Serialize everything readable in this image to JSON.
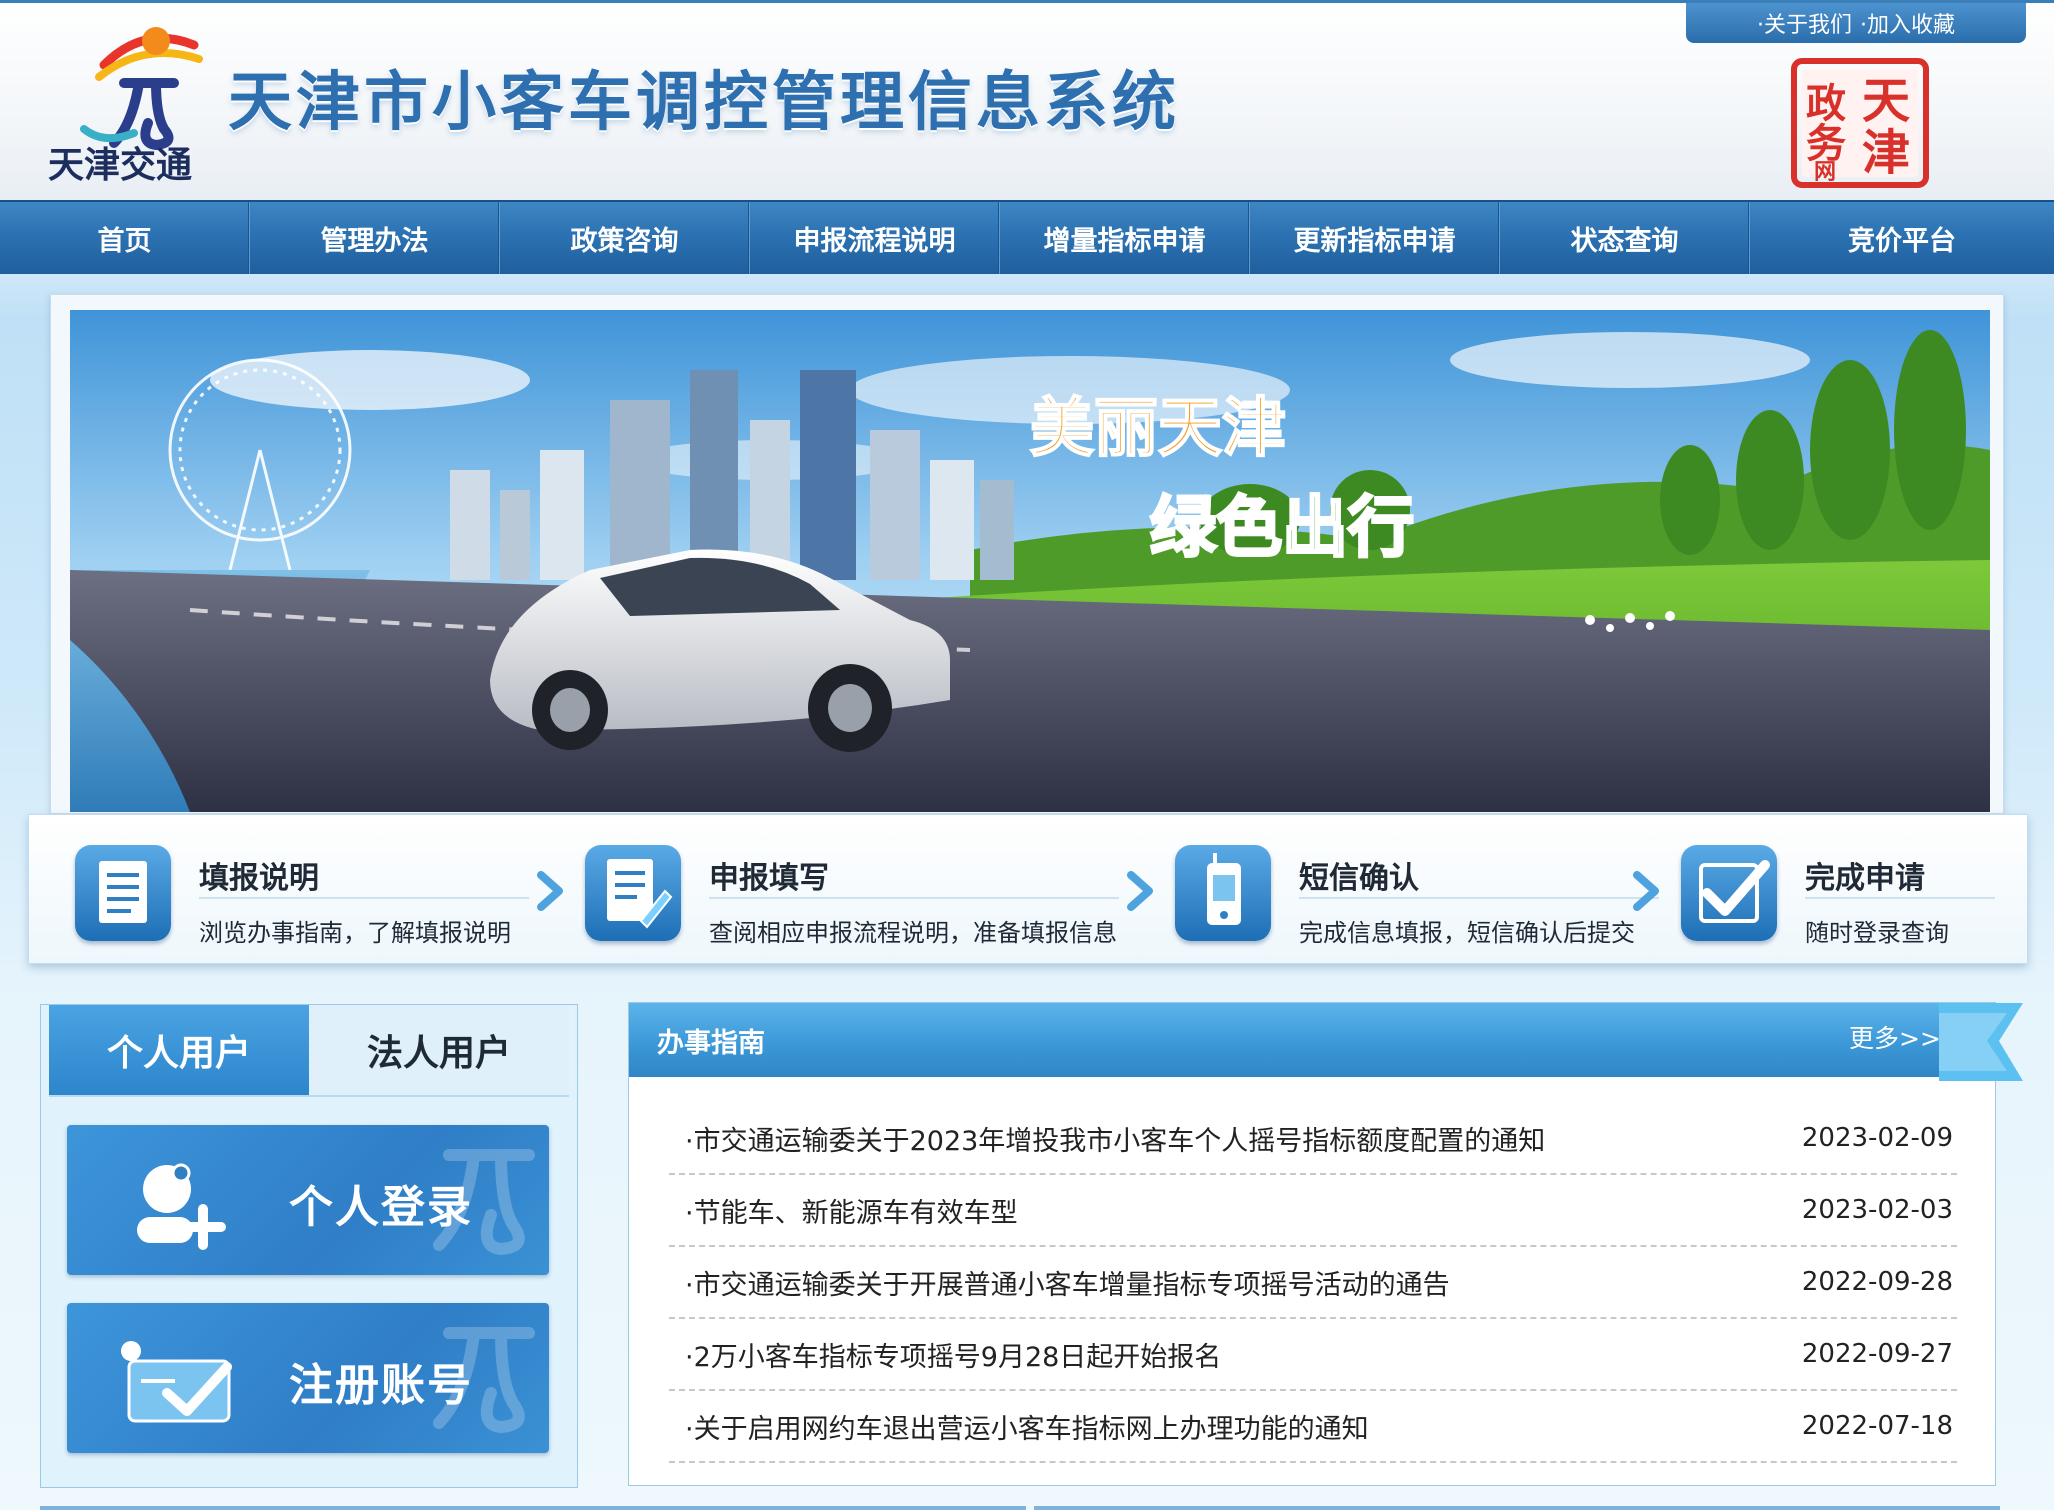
{
  "header": {
    "site_title": "天津市小客车调控管理信息系统",
    "logo_text": "天津交通",
    "seal_text": "天津政务网",
    "top_links": [
      "·关于我们",
      "·加入收藏"
    ]
  },
  "nav": {
    "items": [
      "首页",
      "管理办法",
      "政策咨询",
      "申报流程说明",
      "增量指标申请",
      "更新指标申请",
      "状态查询",
      "竞价平台"
    ]
  },
  "banner": {
    "slogan_1": "美丽天津",
    "slogan_2": "绿色出行"
  },
  "steps": [
    {
      "title": "填报说明",
      "desc": "浏览办事指南，了解填报说明",
      "icon": "document-icon"
    },
    {
      "title": "申报填写",
      "desc": "查阅相应申报流程说明，准备填报信息",
      "icon": "form-edit-icon"
    },
    {
      "title": "短信确认",
      "desc": "完成信息填报，短信确认后提交",
      "icon": "phone-icon"
    },
    {
      "title": "完成申请",
      "desc": "随时登录查询",
      "icon": "checkmark-icon"
    }
  ],
  "login": {
    "tabs": [
      "个人用户",
      "法人用户"
    ],
    "active_tab": "个人用户",
    "personal_login": "个人登录",
    "register": "注册账号"
  },
  "guide": {
    "title": "办事指南",
    "more": "更多>>",
    "items": [
      {
        "title": "·市交通运输委关于2023年增投我市小客车个人摇号指标额度配置的通知",
        "date": "2023-02-09"
      },
      {
        "title": "·节能车、新能源车有效车型",
        "date": "2023-02-03"
      },
      {
        "title": "·市交通运输委关于开展普通小客车增量指标专项摇号活动的通告",
        "date": "2022-09-28"
      },
      {
        "title": "·2万小客车指标专项摇号9月28日起开始报名",
        "date": "2022-09-27"
      },
      {
        "title": "·关于启用网约车退出营运小客车指标网上办理功能的通知",
        "date": "2022-07-18"
      }
    ]
  },
  "colors": {
    "brand_blue": "#2c72b2",
    "title_blue": "#2e6fb0",
    "seal_red": "#d8312b",
    "slogan_orange": "#f39a1c",
    "slogan_green": "#3db13a"
  }
}
